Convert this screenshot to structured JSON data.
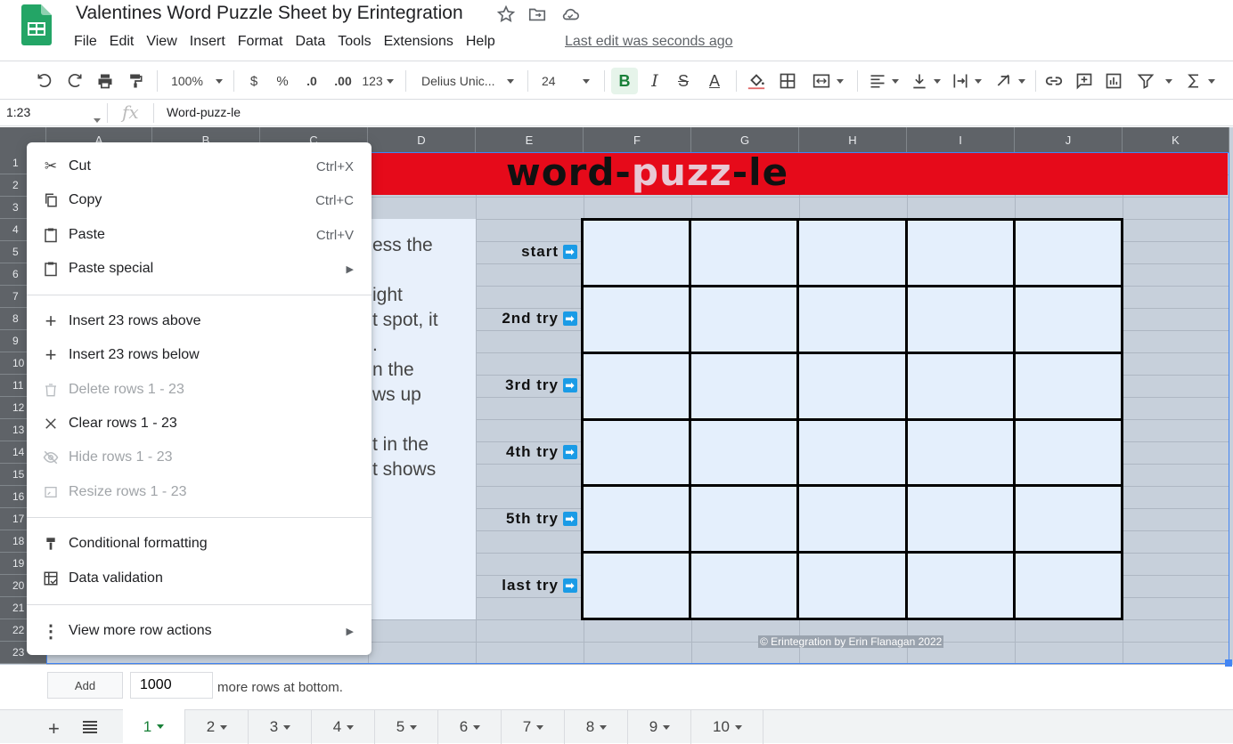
{
  "app": {
    "doc_title": "Valentines Word Puzzle Sheet by Erintegration",
    "last_edit": "Last edit was seconds ago"
  },
  "menu": [
    "File",
    "Edit",
    "View",
    "Insert",
    "Format",
    "Data",
    "Tools",
    "Extensions",
    "Help"
  ],
  "toolbar": {
    "zoom": "100%",
    "currency": "$",
    "percent": "%",
    "dec_decrease": ".0",
    "dec_increase": ".00",
    "number_format": "123",
    "font": "Delius Unic...",
    "font_size": "24",
    "bold": "B",
    "italic": "I",
    "strike": "S",
    "text_color": "A"
  },
  "formula_bar": {
    "name_box": "1:23",
    "fx": "fx",
    "content": "Word-puzz-le"
  },
  "columns": [
    "A",
    "B",
    "C",
    "D",
    "E",
    "F",
    "G",
    "H",
    "I",
    "J",
    "K"
  ],
  "rows": [
    "1",
    "2",
    "3",
    "4",
    "5",
    "6",
    "7",
    "8",
    "9",
    "10",
    "11",
    "12",
    "13",
    "14",
    "15",
    "16",
    "17",
    "18",
    "19",
    "20",
    "21",
    "22",
    "23"
  ],
  "sheet": {
    "title_part1": "word-",
    "title_part2": "puzz",
    "title_part3": "-le",
    "instructions": [
      "ess the",
      "ight",
      "t spot, it",
      ".",
      "n the",
      "ws up",
      "t in the",
      "t shows"
    ],
    "tries": [
      "start",
      "2nd try",
      "3rd try",
      "4th try",
      "5th try",
      "last try"
    ],
    "copyright": "© Erintegration by Erin Flanagan 2022",
    "accent_color": "#e60a1a",
    "tile_color": "#e4effc"
  },
  "bottom": {
    "add_label": "Add",
    "rows_value": "1000",
    "rows_text": "more rows at bottom."
  },
  "tabs": [
    "1",
    "2",
    "3",
    "4",
    "5",
    "6",
    "7",
    "8",
    "9",
    "10"
  ],
  "active_tab": "1",
  "context_menu": {
    "cut": {
      "label": "Cut",
      "shortcut": "Ctrl+X"
    },
    "copy": {
      "label": "Copy",
      "shortcut": "Ctrl+C"
    },
    "paste": {
      "label": "Paste",
      "shortcut": "Ctrl+V"
    },
    "paste_special": {
      "label": "Paste special"
    },
    "insert_above": {
      "label": "Insert 23 rows above"
    },
    "insert_below": {
      "label": "Insert 23 rows below"
    },
    "delete_rows": {
      "label": "Delete rows 1 - 23"
    },
    "clear_rows": {
      "label": "Clear rows 1 - 23"
    },
    "hide_rows": {
      "label": "Hide rows 1 - 23"
    },
    "resize_rows": {
      "label": "Resize rows 1 - 23"
    },
    "conditional": {
      "label": "Conditional formatting"
    },
    "validation": {
      "label": "Data validation"
    },
    "more_actions": {
      "label": "View more row actions"
    }
  }
}
